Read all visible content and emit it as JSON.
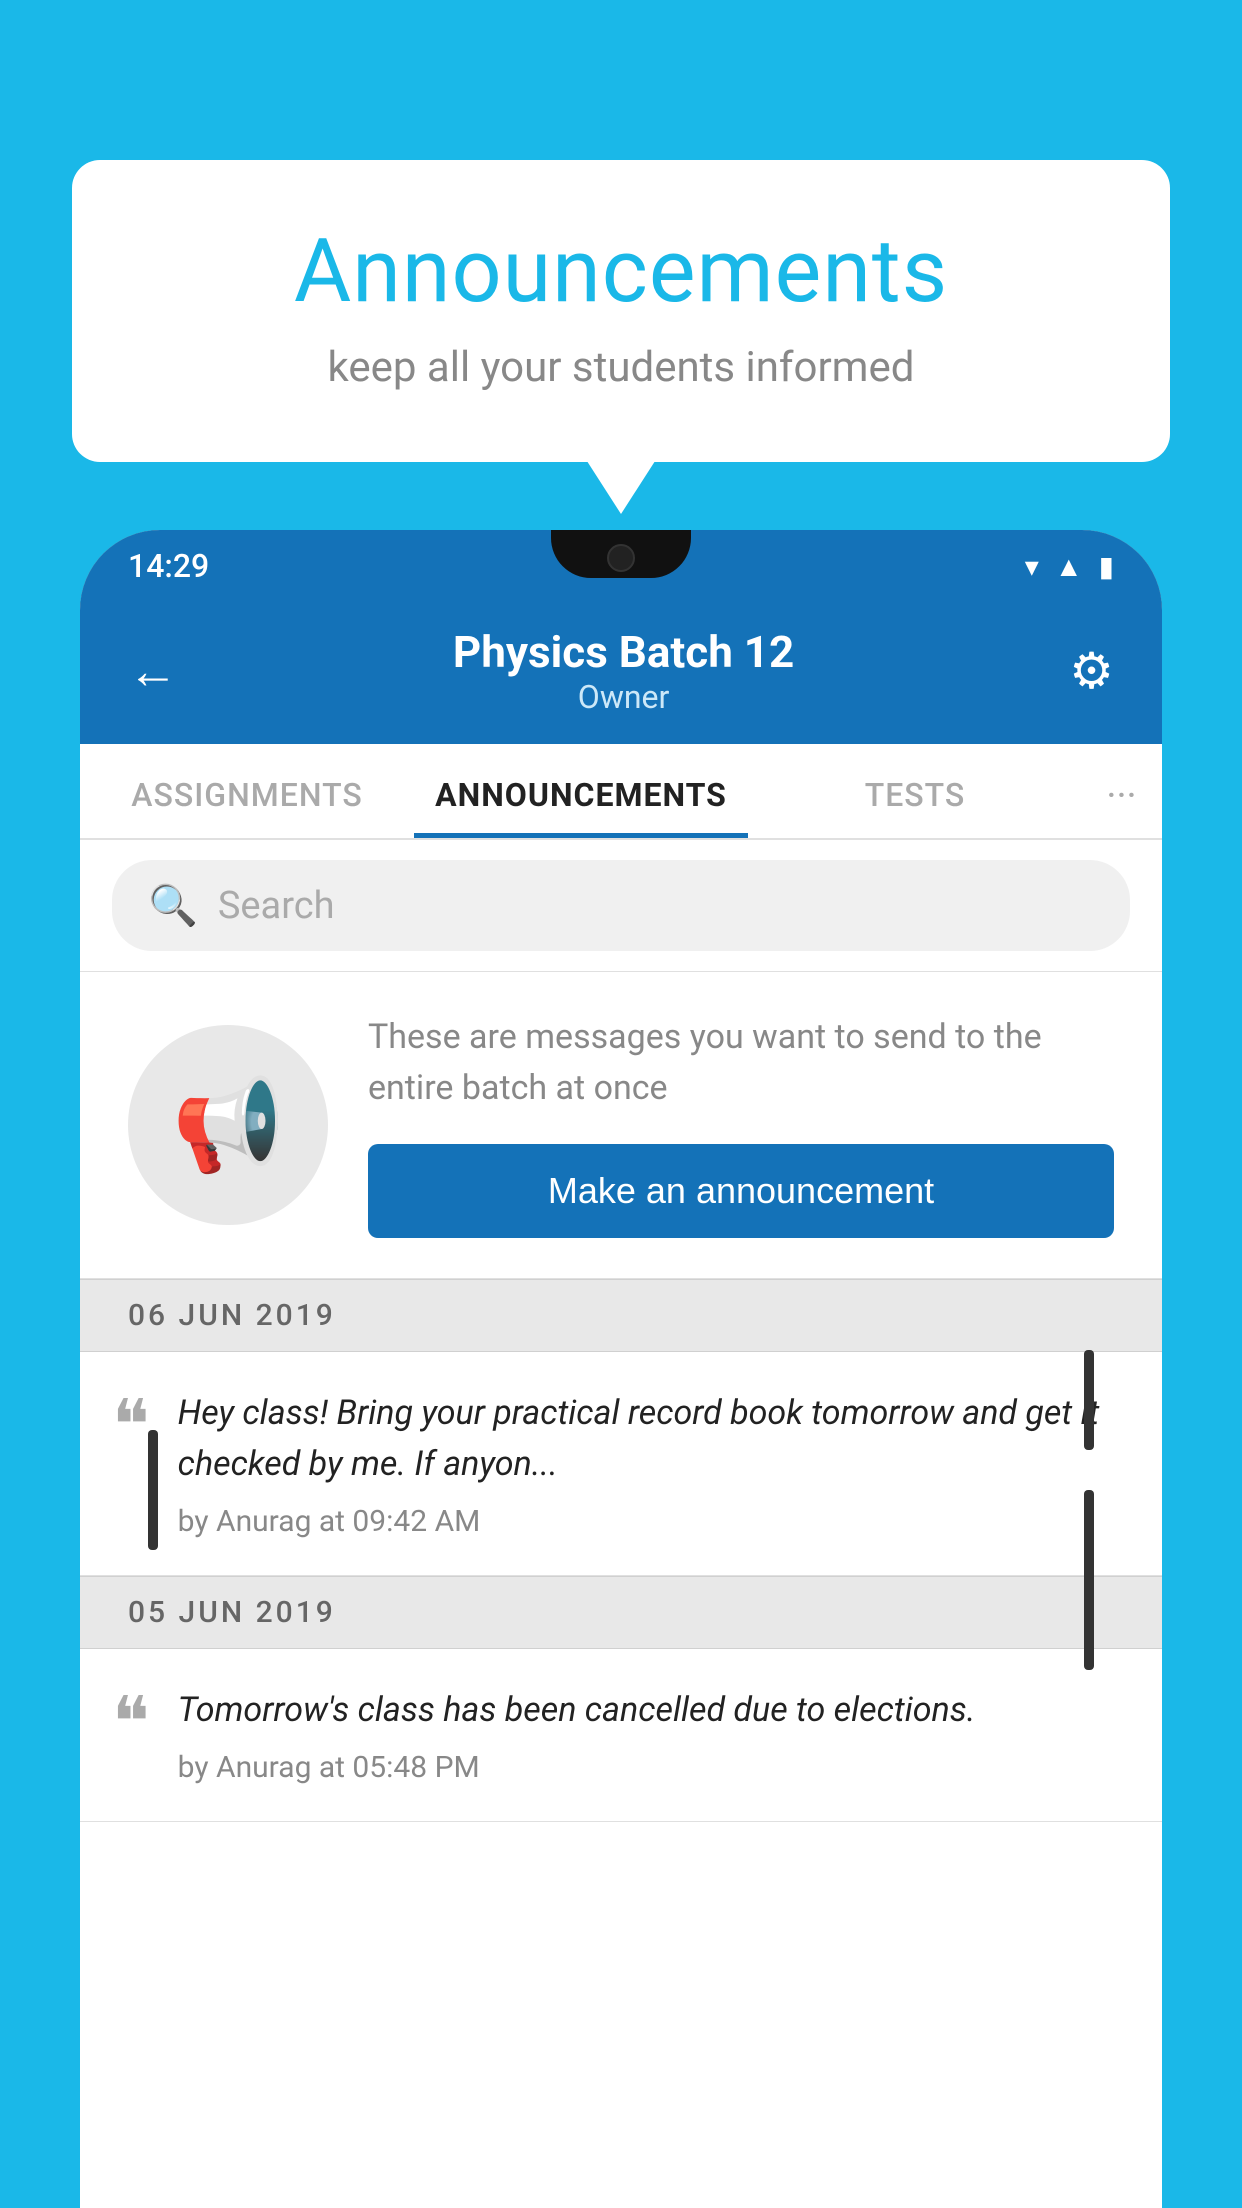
{
  "background_color": "#1ab8e8",
  "speech_bubble": {
    "title": "Announcements",
    "subtitle": "keep all your students informed"
  },
  "phone": {
    "status_bar": {
      "time": "14:29",
      "icons": [
        "wifi",
        "signal",
        "battery"
      ]
    },
    "header": {
      "back_label": "←",
      "title": "Physics Batch 12",
      "subtitle": "Owner",
      "gear_label": "⚙"
    },
    "tabs": [
      {
        "label": "ASSIGNMENTS",
        "active": false
      },
      {
        "label": "ANNOUNCEMENTS",
        "active": true
      },
      {
        "label": "TESTS",
        "active": false
      },
      {
        "label": "···",
        "active": false
      }
    ],
    "search": {
      "placeholder": "Search"
    },
    "promo": {
      "text": "These are messages you want to send to the entire batch at once",
      "button_label": "Make an announcement"
    },
    "announcements": [
      {
        "date": "06  JUN  2019",
        "text": "Hey class! Bring your practical record book tomorrow and get it checked by me. If anyon...",
        "meta": "by Anurag at 09:42 AM"
      },
      {
        "date": "05  JUN  2019",
        "text": "Tomorrow's class has been cancelled due to elections.",
        "meta": "by Anurag at 05:48 PM"
      }
    ]
  }
}
